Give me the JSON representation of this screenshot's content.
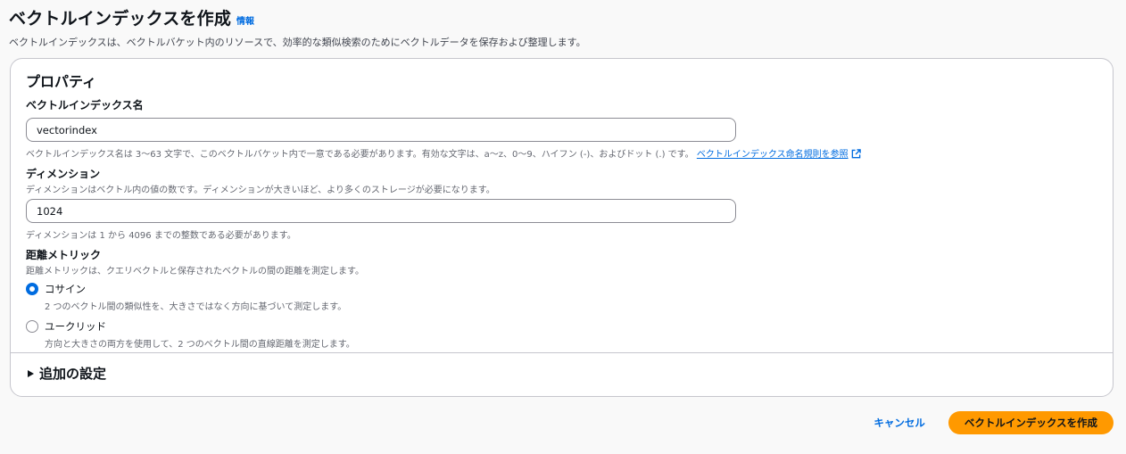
{
  "header": {
    "title": "ベクトルインデックスを作成",
    "info_link": "情報",
    "description": "ベクトルインデックスは、ベクトルバケット内のリソースで、効率的な類似検索のためにベクトルデータを保存および整理します。"
  },
  "properties": {
    "section_title": "プロパティ",
    "index_name": {
      "label": "ベクトルインデックス名",
      "value": "vectorindex",
      "hint": "ベクトルインデックス名は 3〜63 文字で、このベクトルバケット内で一意である必要があります。有効な文字は、a〜z、0〜9、ハイフン (-)、およびドット (.) です。",
      "link": "ベクトルインデックス命名規則を参照"
    },
    "dimension": {
      "label": "ディメンション",
      "description": "ディメンションはベクトル内の値の数です。ディメンションが大きいほど、より多くのストレージが必要になります。",
      "value": "1024",
      "hint": "ディメンションは 1 から 4096 までの整数である必要があります。"
    },
    "distance_metric": {
      "label": "距離メトリック",
      "description": "距離メトリックは、クエリベクトルと保存されたベクトルの間の距離を測定します。",
      "options": [
        {
          "label": "コサイン",
          "description": "2 つのベクトル間の類似性を、大きさではなく方向に基づいて測定します。",
          "selected": true
        },
        {
          "label": "ユークリッド",
          "description": "方向と大きさの両方を使用して、2 つのベクトル間の直線距離を測定します。",
          "selected": false
        }
      ]
    }
  },
  "additional_settings": {
    "label": "追加の設定"
  },
  "actions": {
    "cancel_label": "キャンセル",
    "create_label": "ベクトルインデックスを作成"
  },
  "colors": {
    "accent": "#006ce0",
    "primary_button": "#ff9900",
    "border": "#c6c6cd"
  }
}
